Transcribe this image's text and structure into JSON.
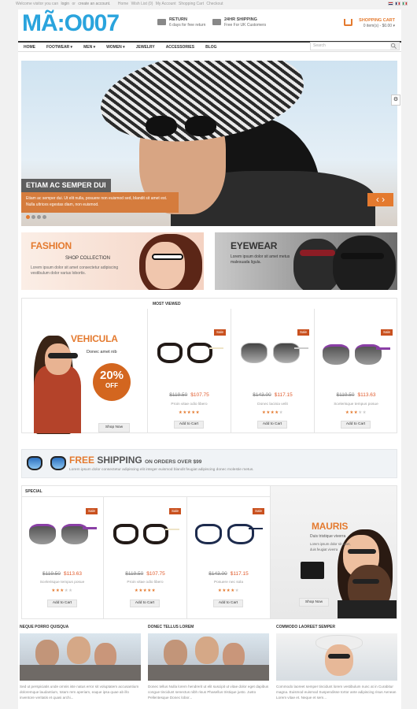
{
  "topbar": {
    "welcome": "Welcome visitor you can",
    "login": "login",
    "or": "or",
    "create": "create an account.",
    "links": [
      "Home",
      "Wish List (0)",
      "My Account",
      "Shopping Cart",
      "Checkout"
    ]
  },
  "logo": "MÃ:O007",
  "return": {
    "title": "RETURN",
    "sub": "6 days for free return"
  },
  "shipping_info": {
    "title": "24HR SHIPPING",
    "sub": "Free For UK Customers"
  },
  "cart": {
    "title": "SHOPPING CART",
    "sub": "0 item(s) - $0.00"
  },
  "nav": [
    "HOME",
    "FOOTWEAR ▾",
    "MEN ▾",
    "WOMEN ▾",
    "JEWELRY",
    "ACCESSORIES",
    "BLOG"
  ],
  "search": {
    "placeholder": "Search"
  },
  "hero": {
    "title": "ETIAM AC SEMPER DUI",
    "text": "Etiam ac semper dui. Ut elit nulla, posuere non euismod sed, blandit sit amet est. Nulla ultrices egestas diam, non euismod.",
    "arrows": "‹ ›"
  },
  "banner1": {
    "title": "FASHION",
    "sub": "SHOP COLLECTION",
    "text": "Lorem ipsum dolor sit amet consectetur adipiscing vestibulum dolor varius lobortis."
  },
  "banner2": {
    "title": "EYEWEAR",
    "text": "Lorem ipsum dolor sit amet metus malesuada ligula."
  },
  "promo": {
    "title": "VEHICULA",
    "sub": "Donec amet nib",
    "pct": "20%",
    "off": "OFF",
    "btn": "Shop Now"
  },
  "most_viewed": {
    "title": "MOST VIEWED",
    "sale": "Sale",
    "add": "Add to Cart",
    "items": [
      {
        "old": "$119.50",
        "new": "$107.75",
        "name": "Proin vitae odio libero",
        "stars": "★★★★★",
        "empty": ""
      },
      {
        "old": "$143.00",
        "new": "$117.15",
        "name": "Donec lacinia velit",
        "stars": "★★★★",
        "empty": "★"
      },
      {
        "old": "$119.50",
        "new": "$113.63",
        "name": "Scelerisque tempus posue",
        "stars": "★★★",
        "empty": "★★"
      }
    ]
  },
  "free_shipping": {
    "free": "FREE",
    "shipping": "SHIPPING",
    "on": "ON ORDERS OVER $99",
    "text": "Lorem ipsum dolor consectetur adipiscing elit integer euismod blandit feugiat adipiscing donec molestie metus."
  },
  "special": {
    "title": "SPECIAL",
    "items": [
      {
        "old": "$119.50",
        "new": "$113.63",
        "name": "Scelerisque tempus posue",
        "stars": "★★★",
        "empty": "★★"
      },
      {
        "old": "$119.50",
        "new": "$107.75",
        "name": "Proin vitae odio libero",
        "stars": "★★★★★",
        "empty": ""
      },
      {
        "old": "$143.00",
        "new": "$117.15",
        "name": "Posuere nec sola",
        "stars": "★★★★",
        "empty": "★"
      }
    ]
  },
  "mauris": {
    "title": "MAURIS",
    "sub": "Duis tristique viverra",
    "text": "Lorem ipsum dolor sit amet, duis feugiat viverra",
    "btn": "Shop Now"
  },
  "blog": [
    {
      "title": "NEQUE PORRO QUISQUA",
      "text": "Sed ut perspiciatis unde omnis iste natus error sit voluptatem accusantium doloremque laudantium, totam rem aperiam, eaque ipsa quae ab illo inventore veritatis et quasi archi..."
    },
    {
      "title": "DONEC TELLUS LOREM",
      "text": "Donec tellus Nulla lorem hendrerit ut elit suscipit ut vitae dolor eget dapibus congue tincidunt senectus nibh risus Phasellus tristique justo. Justo Pellentesque Donec lobor..."
    },
    {
      "title": "COMMODO LAOREET SEMPER",
      "text": "Commodo laoreet semper tincidunt lorem vestibulum nunc at in Curabitur magna. Euismod euismod Suspendisse tortor ante adipiscing risus Aenean Lorem vitae et. Neque et sem..."
    }
  ],
  "colors": {
    "accent": "#e47a2f",
    "sale": "#c9511f",
    "logo": "#2aa4dd",
    "price": "#e05a2b"
  }
}
